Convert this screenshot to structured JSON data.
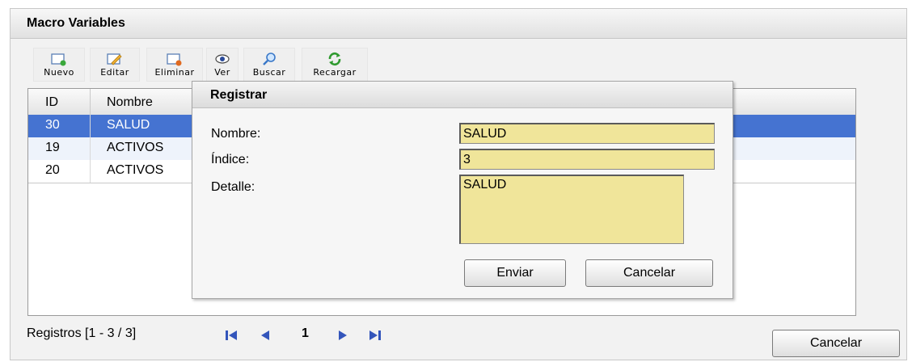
{
  "panel": {
    "title": "Macro Variables"
  },
  "toolbar": {
    "nuevo": "Nuevo",
    "editar": "Editar",
    "eliminar": "Eliminar",
    "ver": "Ver",
    "buscar": "Buscar",
    "recargar": "Recargar"
  },
  "grid": {
    "columns": [
      "ID",
      "Nombre"
    ],
    "rows": [
      {
        "id": "30",
        "nombre": "SALUD"
      },
      {
        "id": "19",
        "nombre": "ACTIVOS"
      },
      {
        "id": "20",
        "nombre": "ACTIVOS"
      }
    ],
    "selected_row": "30"
  },
  "pager": {
    "text": "Registros [1 - 3 / 3]",
    "page": "1"
  },
  "footer": {
    "cancel_label": "Cancelar"
  },
  "dialog": {
    "title": "Registrar",
    "fields": {
      "nombre_label": "Nombre:",
      "nombre_value": "SALUD",
      "indice_label": "Índice:",
      "indice_value": "3",
      "detalle_label": "Detalle:",
      "detalle_value": "SALUD"
    },
    "submit_label": "Enviar",
    "cancel_label": "Cancelar"
  },
  "colors": {
    "selection": "#4573d1",
    "field_bg": "#f0e59a",
    "pager_arrows": "#3355bb"
  }
}
